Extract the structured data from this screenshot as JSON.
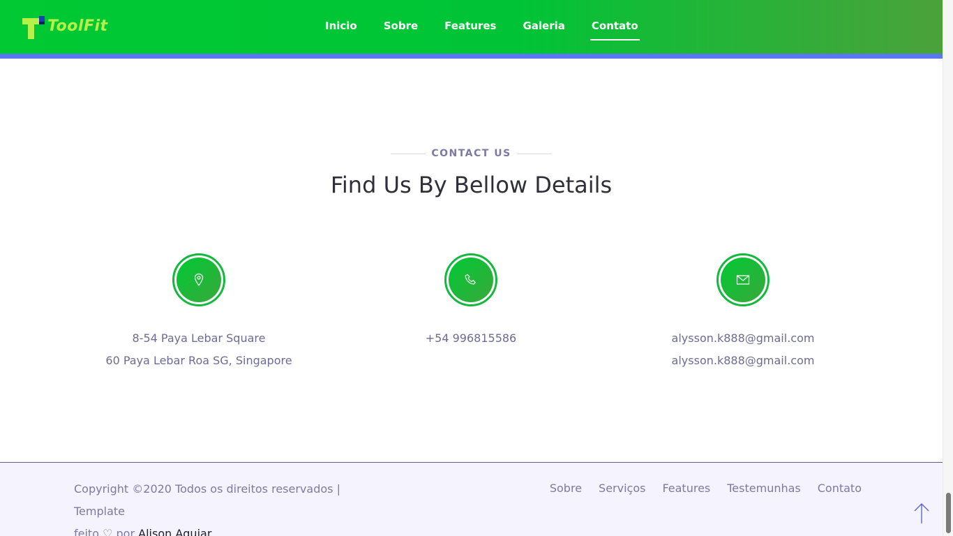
{
  "header": {
    "logo_text": "ToolFit",
    "nav": [
      {
        "label": "Inicio",
        "active": false
      },
      {
        "label": "Sobre",
        "active": false
      },
      {
        "label": "Features",
        "active": false
      },
      {
        "label": "Galeria",
        "active": false
      },
      {
        "label": "Contato",
        "active": true
      }
    ]
  },
  "contact": {
    "eyebrow": "CONTACT US",
    "title": "Find Us By Bellow Details",
    "cards": [
      {
        "icon": "location-pin-icon",
        "lines": [
          "8-54 Paya Lebar Square",
          "60 Paya Lebar Roa SG, Singapore"
        ]
      },
      {
        "icon": "phone-icon",
        "lines": [
          "+54 996815586"
        ]
      },
      {
        "icon": "mail-icon",
        "lines": [
          "alysson.k888@gmail.com",
          "alysson.k888@gmail.com"
        ]
      }
    ]
  },
  "footer": {
    "copyright_prefix": "Copyright ©2020 Todos os direitos reservados | Template",
    "copyright_feito": "feito",
    "copyright_por": "por",
    "author": "Alison Aguiar",
    "links": [
      "Sobre",
      "Serviços",
      "Features",
      "Testemunhas",
      "Contato"
    ]
  },
  "colors": {
    "header_green": "#00c933",
    "header_border": "#5b78f2",
    "icon_green": "#11b93c",
    "muted_text": "#7c7aa3",
    "footer_bg": "#f4f3fe"
  }
}
